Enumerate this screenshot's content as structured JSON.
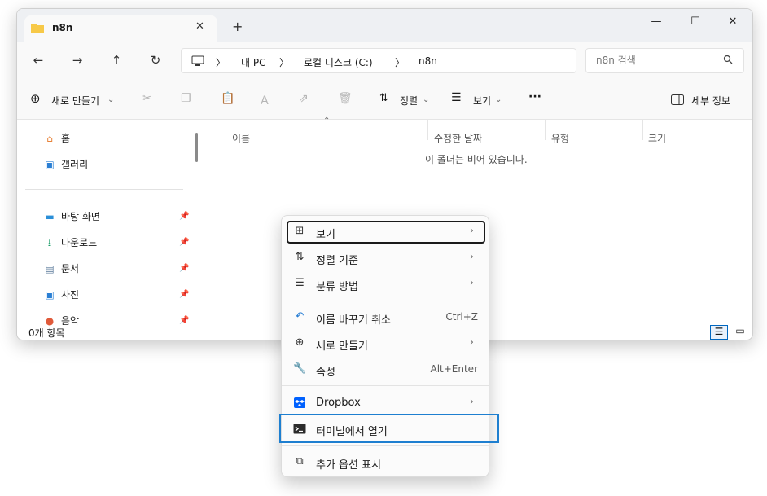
{
  "window": {
    "tab_title": "n8n",
    "tab_close": "✕",
    "new_tab": "+",
    "minimize": "—",
    "maximize": "☐",
    "close": "✕"
  },
  "nav": {
    "back": "←",
    "forward": "→",
    "up": "↑",
    "refresh": "↻",
    "breadcrumb": [
      "내 PC",
      "로컬 디스크 (C:)",
      "n8n"
    ],
    "separator": "〉",
    "search_placeholder": "n8n 검색"
  },
  "toolbar": {
    "new_label": "새로 만들기",
    "sort_label": "정렬",
    "view_label": "보기",
    "more": "···",
    "details_label": "세부 정보"
  },
  "sidebar": {
    "items": [
      {
        "label": "홈",
        "icon": "home-icon"
      },
      {
        "label": "갤러리",
        "icon": "gallery-icon"
      },
      {
        "label": "바탕 화면",
        "icon": "desktop-icon"
      },
      {
        "label": "다운로드",
        "icon": "download-icon"
      },
      {
        "label": "문서",
        "icon": "document-icon"
      },
      {
        "label": "사진",
        "icon": "pictures-icon"
      },
      {
        "label": "음악",
        "icon": "music-icon"
      }
    ]
  },
  "content": {
    "columns": [
      "이름",
      "수정한 날짜",
      "유형",
      "크기"
    ],
    "empty_message": "이 폴더는 비어 있습니다."
  },
  "status": {
    "count": "0개 항목"
  },
  "context_menu": {
    "items": [
      {
        "label": "보기",
        "icon": "grid-icon",
        "has_submenu": true
      },
      {
        "label": "정렬 기준",
        "icon": "sort-icon",
        "has_submenu": true
      },
      {
        "label": "분류 방법",
        "icon": "group-icon",
        "has_submenu": true
      },
      {
        "label": "이름 바꾸기 취소",
        "icon": "undo-icon",
        "shortcut": "Ctrl+Z"
      },
      {
        "label": "새로 만들기",
        "icon": "new-icon",
        "has_submenu": true
      },
      {
        "label": "속성",
        "icon": "wrench-icon",
        "shortcut": "Alt+Enter"
      },
      {
        "label": "Dropbox",
        "icon": "dropbox-icon",
        "has_submenu": true
      },
      {
        "label": "터미널에서 열기",
        "icon": "terminal-icon"
      },
      {
        "label": "추가 옵션 표시",
        "icon": "more-options-icon"
      }
    ]
  },
  "colors": {
    "accent": "#0067c0",
    "highlight": "#1e7fd0",
    "dropbox": "#0061fe"
  }
}
